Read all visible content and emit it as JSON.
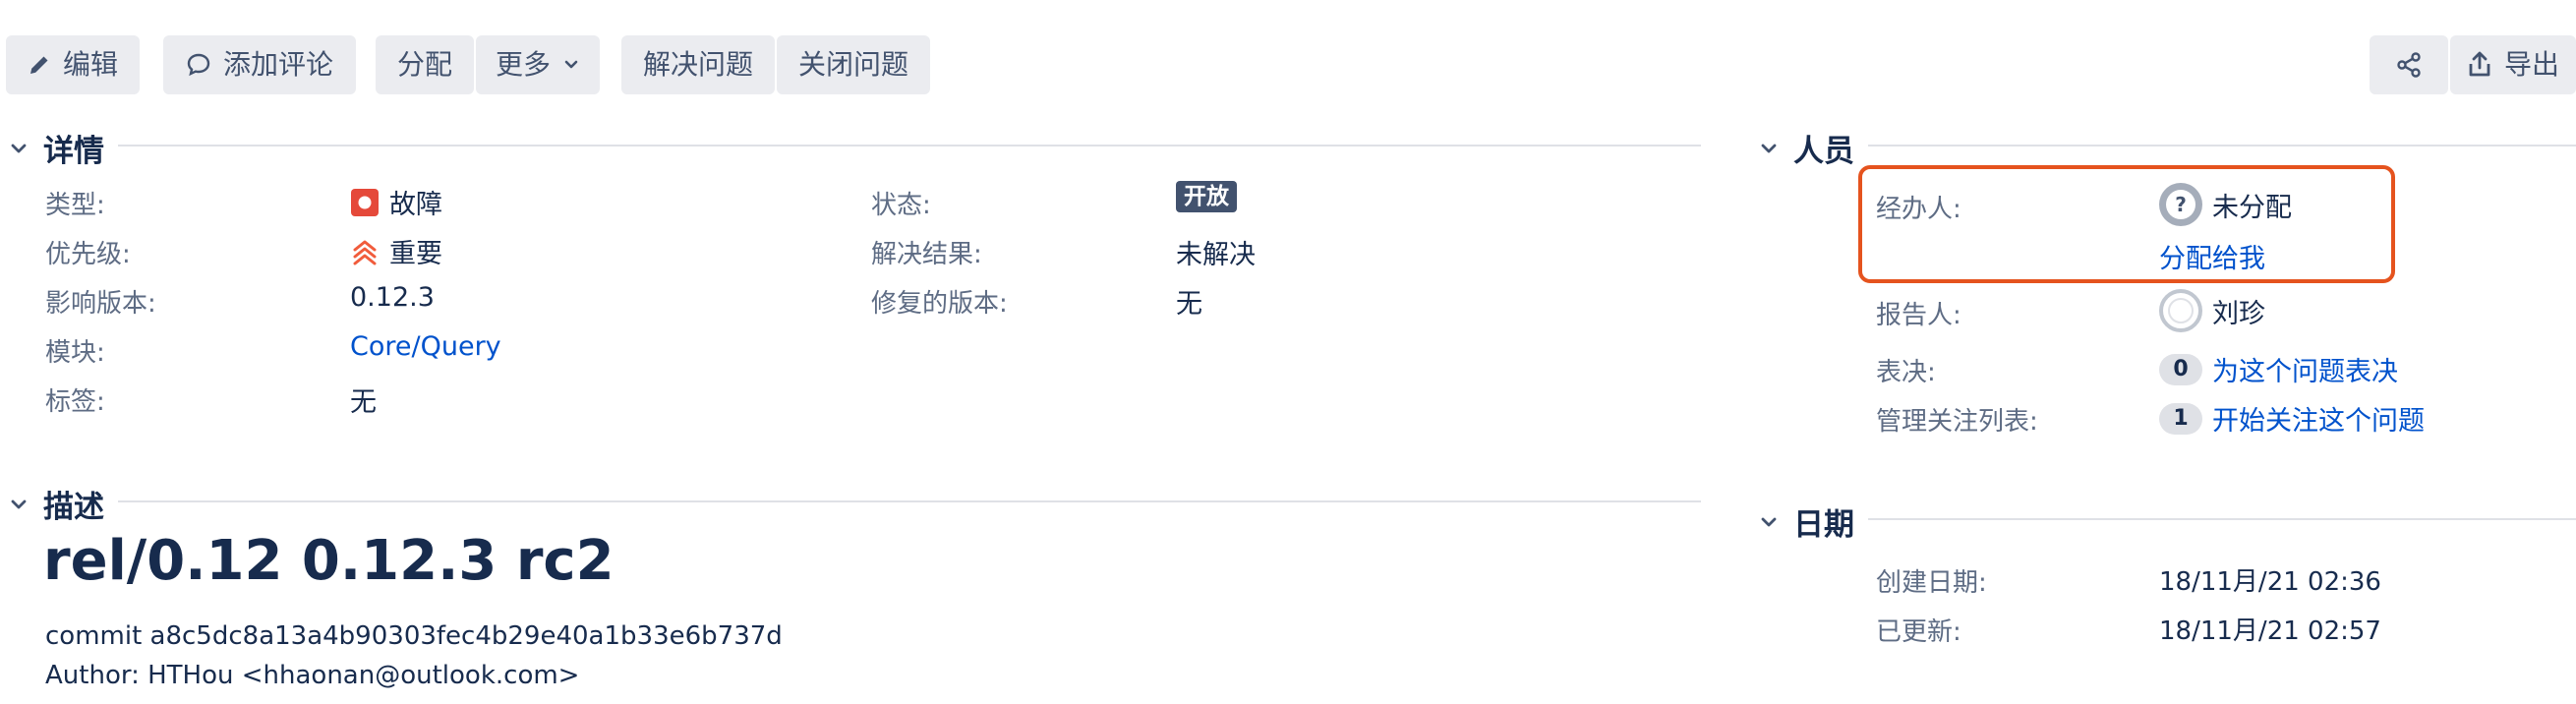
{
  "toolbar": {
    "edit": "编辑",
    "add_comment": "添加评论",
    "assign": "分配",
    "more": "更多",
    "resolve": "解决问题",
    "close": "关闭问题",
    "export": "导出",
    "share_icon": "share-icon"
  },
  "details": {
    "title": "详情",
    "type_label": "类型:",
    "type_value": "故障",
    "priority_label": "优先级:",
    "priority_value": "重要",
    "affects_label": "影响版本:",
    "affects_value": "0.12.3",
    "component_label": "模块:",
    "component_value": "Core/Query",
    "labels_label": "标签:",
    "labels_value": "无",
    "status_label": "状态:",
    "status_value": "开放",
    "resolution_label": "解决结果:",
    "resolution_value": "未解决",
    "fix_label": "修复的版本:",
    "fix_value": "无"
  },
  "description": {
    "title": "描述",
    "heading": "rel/0.12 0.12.3 rc2",
    "line1": "commit a8c5dc8a13a4b90303fec4b29e40a1b33e6b737d",
    "line2": "Author: HTHou <hhaonan@outlook.com>"
  },
  "people": {
    "title": "人员",
    "assignee_label": "经办人:",
    "assignee_value": "未分配",
    "assign_to_me": "分配给我",
    "reporter_label": "报告人:",
    "reporter_value": "刘珍",
    "votes_label": "表决:",
    "votes_count": "0",
    "votes_link": "为这个问题表决",
    "watchers_label": "管理关注列表:",
    "watchers_count": "1",
    "watchers_link": "开始关注这个问题"
  },
  "dates": {
    "title": "日期",
    "created_label": "创建日期:",
    "created_value": "18/11月/21 02:36",
    "updated_label": "已更新:",
    "updated_value": "18/11月/21 02:57"
  },
  "colors": {
    "highlight_border": "#e5531e",
    "bug_icon": "#e5493a",
    "priority_icon": "#f15c3c",
    "link": "#0052cc"
  }
}
